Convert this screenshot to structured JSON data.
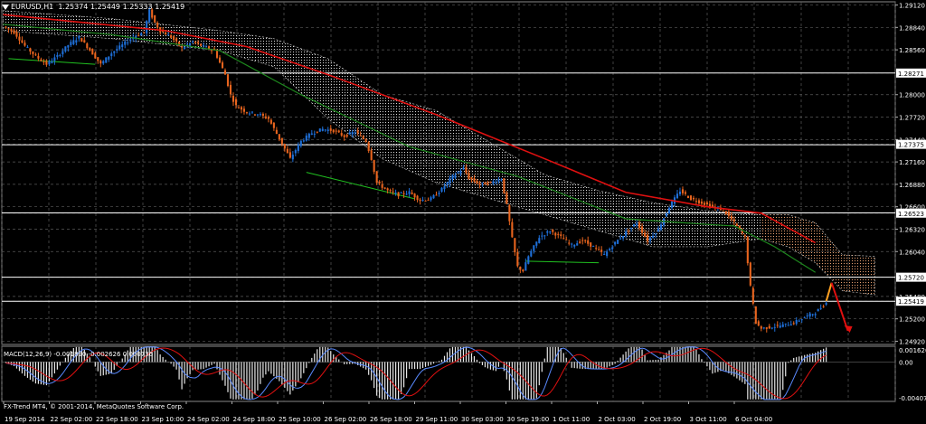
{
  "header": {
    "symbol": "EURUSD,H1",
    "ohlc": "1.25374 1.25449 1.25333 1.25419"
  },
  "macd_label": "MACD(12,26,9) -0.001890 -0.002626 0.000736",
  "copyright": "FX-Trend MT4, © 2001-2014, MetaQuotes Software Corp.",
  "colors": {
    "background": "#000000",
    "grid": "#5a5a5a",
    "bull": "#1e6fd8",
    "bear": "#e8641e",
    "ma_fast": "#e01010",
    "ma_slow": "#1e8a1e",
    "cloud": "#d8d8d8",
    "cloud_orange": "#e8a070",
    "hline": "#ffffff",
    "signal_line": "#5a8aff"
  },
  "chart_data": {
    "type": "candlestick",
    "instrument": "EURUSD",
    "timeframe": "H1",
    "price_axis": {
      "ticks": [
        1.2912,
        1.2884,
        1.2856,
        1.2827,
        1.28,
        1.2772,
        1.2744,
        1.2738,
        1.2716,
        1.2688,
        1.266,
        1.2652,
        1.2632,
        1.2604,
        1.2572,
        1.2548,
        1.2542,
        1.252,
        1.2492
      ],
      "tick_labels": [
        "1.29120",
        "1.28840",
        "1.28560",
        "1.28271",
        "1.28000",
        "1.27720",
        "1.27440",
        "1.27375",
        "1.27160",
        "1.26880",
        "1.26600",
        "1.26523",
        "1.26320",
        "1.26040",
        "1.25720",
        "1.25480",
        "1.25419",
        "1.25200",
        "1.24920"
      ],
      "highlighted": [
        {
          "label": "1.28271",
          "value": 1.28271
        },
        {
          "label": "1.27375",
          "value": 1.27375
        },
        {
          "label": "1.26523",
          "value": 1.26523
        },
        {
          "label": "1.25720",
          "value": 1.2572
        },
        {
          "label": "1.25419",
          "value": 1.25419
        }
      ],
      "ylim": [
        1.2488,
        1.2916
      ]
    },
    "time_axis": {
      "labels": [
        "19 Sep 2014",
        "22 Sep 02:00",
        "22 Sep 18:00",
        "23 Sep 10:00",
        "24 Sep 02:00",
        "24 Sep 18:00",
        "25 Sep 10:00",
        "26 Sep 02:00",
        "26 Sep 18:00",
        "29 Sep 11:00",
        "30 Sep 03:00",
        "30 Sep 19:00",
        "1 Oct 11:00",
        "2 Oct 03:00",
        "2 Oct 19:00",
        "3 Oct 11:00",
        "6 Oct 04:00"
      ]
    },
    "horizontal_lines": [
      1.28271,
      1.27375,
      1.26523,
      1.2572,
      1.25419
    ],
    "close_path": [
      [
        0,
        1.2885
      ],
      [
        4,
        1.2878
      ],
      [
        8,
        1.2861
      ],
      [
        12,
        1.2848
      ],
      [
        16,
        1.2838
      ],
      [
        20,
        1.2848
      ],
      [
        24,
        1.2862
      ],
      [
        28,
        1.2872
      ],
      [
        32,
        1.2856
      ],
      [
        36,
        1.2838
      ],
      [
        40,
        1.2852
      ],
      [
        44,
        1.2862
      ],
      [
        48,
        1.2872
      ],
      [
        52,
        1.2878
      ],
      [
        54,
        1.2905
      ],
      [
        56,
        1.289
      ],
      [
        58,
        1.288
      ],
      [
        62,
        1.2872
      ],
      [
        66,
        1.2858
      ],
      [
        70,
        1.2866
      ],
      [
        74,
        1.286
      ],
      [
        78,
        1.2855
      ],
      [
        82,
        1.2825
      ],
      [
        84,
        1.28
      ],
      [
        86,
        1.2786
      ],
      [
        90,
        1.2778
      ],
      [
        94,
        1.2776
      ],
      [
        98,
        1.277
      ],
      [
        102,
        1.2745
      ],
      [
        106,
        1.272
      ],
      [
        110,
        1.2742
      ],
      [
        114,
        1.2752
      ],
      [
        118,
        1.2757
      ],
      [
        122,
        1.2755
      ],
      [
        126,
        1.2748
      ],
      [
        130,
        1.2754
      ],
      [
        134,
        1.2742
      ],
      [
        136,
        1.272
      ],
      [
        138,
        1.269
      ],
      [
        142,
        1.268
      ],
      [
        146,
        1.2675
      ],
      [
        150,
        1.2678
      ],
      [
        154,
        1.2668
      ],
      [
        158,
        1.267
      ],
      [
        162,
        1.2682
      ],
      [
        166,
        1.2698
      ],
      [
        170,
        1.2708
      ],
      [
        172,
        1.2696
      ],
      [
        176,
        1.2688
      ],
      [
        180,
        1.269
      ],
      [
        184,
        1.2695
      ],
      [
        186,
        1.2662
      ],
      [
        188,
        1.262
      ],
      [
        190,
        1.2585
      ],
      [
        192,
        1.258
      ],
      [
        194,
        1.2598
      ],
      [
        198,
        1.2622
      ],
      [
        202,
        1.263
      ],
      [
        206,
        1.2622
      ],
      [
        210,
        1.2612
      ],
      [
        214,
        1.2618
      ],
      [
        218,
        1.261
      ],
      [
        222,
        1.26
      ],
      [
        226,
        1.2615
      ],
      [
        230,
        1.2628
      ],
      [
        234,
        1.264
      ],
      [
        238,
        1.2618
      ],
      [
        242,
        1.2632
      ],
      [
        246,
        1.266
      ],
      [
        250,
        1.268
      ],
      [
        254,
        1.267
      ],
      [
        258,
        1.2665
      ],
      [
        262,
        1.266
      ],
      [
        266,
        1.2656
      ],
      [
        270,
        1.264
      ],
      [
        274,
        1.2622
      ],
      [
        276,
        1.256
      ],
      [
        278,
        1.2515
      ],
      [
        280,
        1.2508
      ],
      [
        284,
        1.251
      ],
      [
        288,
        1.2512
      ],
      [
        292,
        1.2515
      ],
      [
        296,
        1.2522
      ],
      [
        300,
        1.2528
      ],
      [
        304,
        1.254
      ]
    ],
    "forecast": [
      [
        304,
        1.2542
      ],
      [
        306,
        1.2565
      ],
      [
        309,
        1.2528
      ],
      [
        312,
        1.2505
      ]
    ],
    "ma_fast": [
      [
        0,
        1.29
      ],
      [
        60,
        1.288
      ],
      [
        90,
        1.286
      ],
      [
        120,
        1.2825
      ],
      [
        160,
        1.2775
      ],
      [
        200,
        1.272
      ],
      [
        230,
        1.2678
      ],
      [
        260,
        1.266
      ],
      [
        280,
        1.2652
      ],
      [
        300,
        1.2615
      ]
    ],
    "ma_slow": [
      [
        0,
        1.2888
      ],
      [
        40,
        1.2875
      ],
      [
        80,
        1.2855
      ],
      [
        110,
        1.28
      ],
      [
        150,
        1.2735
      ],
      [
        190,
        1.2698
      ],
      [
        230,
        1.2645
      ],
      [
        260,
        1.2638
      ],
      [
        270,
        1.2636
      ],
      [
        285,
        1.261
      ],
      [
        300,
        1.2578
      ]
    ],
    "cloud": [
      [
        0,
        1.2905,
        1.288
      ],
      [
        40,
        1.2895,
        1.287
      ],
      [
        80,
        1.288,
        1.2855
      ],
      [
        100,
        1.287,
        1.2835
      ],
      [
        120,
        1.2845,
        1.277
      ],
      [
        140,
        1.28,
        1.272
      ],
      [
        160,
        1.278,
        1.269
      ],
      [
        180,
        1.274,
        1.267
      ],
      [
        200,
        1.27,
        1.265
      ],
      [
        220,
        1.268,
        1.263
      ],
      [
        240,
        1.2665,
        1.261
      ],
      [
        260,
        1.2655,
        1.261
      ],
      [
        280,
        1.265,
        1.262
      ],
      [
        290,
        1.265,
        1.261
      ],
      [
        300,
        1.264,
        1.259
      ],
      [
        310,
        1.26,
        1.2555
      ],
      [
        322,
        1.2598,
        1.255
      ]
    ],
    "support_lines": [
      [
        [
          2,
          1.2845
        ],
        [
          34,
          1.2838
        ]
      ],
      [
        [
          112,
          1.2703
        ],
        [
          152,
          1.267
        ]
      ],
      [
        [
          193,
          1.2592
        ],
        [
          220,
          1.259
        ]
      ]
    ],
    "macd": {
      "label": "MACD(12,26,9)",
      "values": [
        -0.00189,
        -0.002626,
        0.000736
      ],
      "axis_ticks": [
        "0.001626",
        "0.00",
        "-0.004070"
      ],
      "ylim": [
        -0.00407,
        0.001626
      ]
    }
  }
}
